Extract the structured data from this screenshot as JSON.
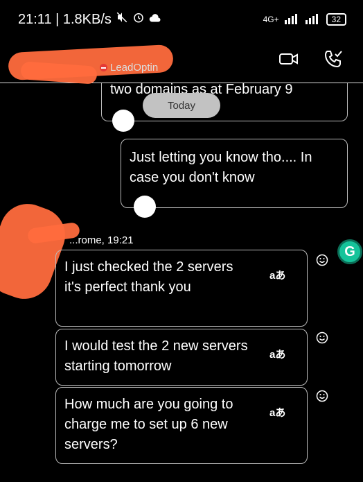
{
  "status_bar": {
    "time_speed": "21:11 | 1.8KB/s",
    "network": "4G+",
    "battery": "32"
  },
  "header": {
    "presence_text": "LeadOptin"
  },
  "chat": {
    "top_partial_message": "two domains as at February 9",
    "date_pill": "Today",
    "outgoing_message": "Just letting you know tho.... In case you don't know",
    "sender_meta": "...rome, 19:21",
    "messages": [
      {
        "text": "I just checked the 2 servers it's perfect thank you",
        "translate": "aあ"
      },
      {
        "text": "I would test the 2 new servers starting tomorrow",
        "translate": "aあ"
      },
      {
        "text": "How much are you going to charge me to set up 6 new servers?",
        "translate": "aあ"
      }
    ]
  },
  "colors": {
    "background": "#000000",
    "bubble_border": "#bbbbbb",
    "redaction": "#ff6b3d",
    "grammarly": "#15c39a"
  }
}
